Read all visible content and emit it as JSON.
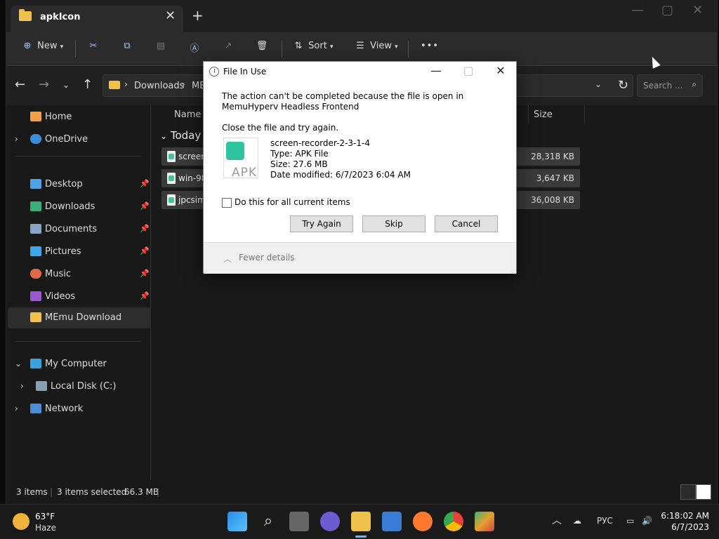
{
  "window": {
    "tab_title": "apkIcon",
    "tab_close": "✕",
    "new_tab": "+",
    "controls": {
      "minimize": "—",
      "maximize": "▢",
      "close": "✕"
    }
  },
  "toolbar": {
    "new_label": "New",
    "sort_label": "Sort",
    "view_label": "View",
    "more_label": "•••"
  },
  "nav": {
    "breadcrumb": [
      "Downloads",
      "ME"
    ],
    "search_placeholder": "Search ..."
  },
  "sidebar": {
    "items": [
      {
        "label": "Home",
        "icon": "home-icon",
        "has_chevron": false,
        "pinned": false
      },
      {
        "label": "OneDrive",
        "icon": "cloud-icon",
        "has_chevron": true,
        "pinned": false
      },
      {
        "label": "Desktop",
        "icon": "desktop-icon",
        "has_chevron": false,
        "pinned": true
      },
      {
        "label": "Downloads",
        "icon": "download-icon",
        "has_chevron": false,
        "pinned": true
      },
      {
        "label": "Documents",
        "icon": "document-icon",
        "has_chevron": false,
        "pinned": true
      },
      {
        "label": "Pictures",
        "icon": "pictures-icon",
        "has_chevron": false,
        "pinned": true
      },
      {
        "label": "Music",
        "icon": "music-icon",
        "has_chevron": false,
        "pinned": true
      },
      {
        "label": "Videos",
        "icon": "videos-icon",
        "has_chevron": false,
        "pinned": true
      },
      {
        "label": "MEmu Download",
        "icon": "folder-icon",
        "has_chevron": false,
        "pinned": false,
        "selected": true
      },
      {
        "label": "My Computer",
        "icon": "computer-icon",
        "has_chevron": true,
        "expanded": true,
        "pinned": false
      },
      {
        "label": "Local Disk (C:)",
        "icon": "disk-icon",
        "has_chevron": true,
        "pinned": false
      },
      {
        "label": "Network",
        "icon": "network-icon",
        "has_chevron": true,
        "pinned": false
      }
    ]
  },
  "content": {
    "columns": {
      "name": "Name",
      "size": "Size"
    },
    "group_label": "Today",
    "rows": [
      {
        "name": "screen",
        "size": "28,318 KB"
      },
      {
        "name": "win-98",
        "size": "3,647 KB"
      },
      {
        "name": "jpcsim",
        "size": "36,008 KB"
      }
    ]
  },
  "status": {
    "count": "3 items",
    "selection": "3 items selected",
    "size": "66.3 MB"
  },
  "dialog": {
    "title": "File In Use",
    "message": "The action can't be completed because the file is open in MemuHyperv Headless Frontend",
    "close_instruction": "Close the file and try again.",
    "file": {
      "name": "screen-recorder-2-3-1-4",
      "type": "Type: APK File",
      "size": "Size: 27.6 MB",
      "date": "Date modified: 6/7/2023 6:04 AM",
      "icon_label": "APK"
    },
    "checkbox_label": "Do this for all current items",
    "buttons": {
      "try_again": "Try Again",
      "skip": "Skip",
      "cancel": "Cancel"
    },
    "fewer_details": "Fewer details"
  },
  "taskbar": {
    "weather_temp": "63°F",
    "weather_desc": "Haze",
    "language": "РУС",
    "time": "6:18:02 AM",
    "date": "6/7/2023"
  }
}
